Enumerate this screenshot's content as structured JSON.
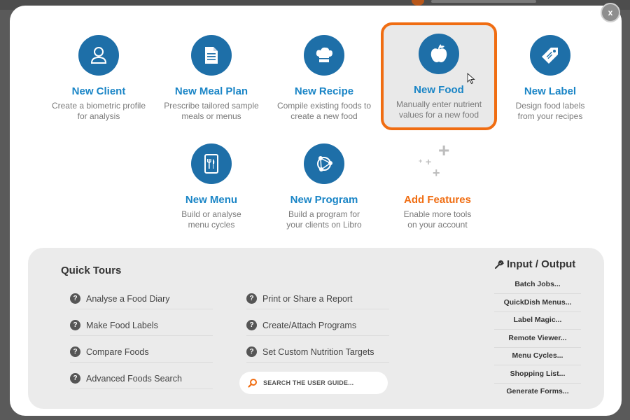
{
  "close_label": "x",
  "tiles": [
    {
      "title": "New Client",
      "desc1": "Create a biometric profile",
      "desc2": "for analysis",
      "icon": "person-icon"
    },
    {
      "title": "New Meal Plan",
      "desc1": "Prescribe tailored sample",
      "desc2": "meals or menus",
      "icon": "document-icon"
    },
    {
      "title": "New Recipe",
      "desc1": "Compile existing foods to",
      "desc2": "create a new food",
      "icon": "chef-hat-icon"
    },
    {
      "title": "New Food",
      "desc1": "Manually enter nutrient",
      "desc2": "values for a new food",
      "icon": "apple-icon"
    },
    {
      "title": "New Label",
      "desc1": "Design food labels",
      "desc2": "from your recipes",
      "icon": "tag-icon"
    },
    {
      "title": "New Menu",
      "desc1": "Build or analyse",
      "desc2": "menu cycles",
      "icon": "tablet-utensils-icon"
    },
    {
      "title": "New Program",
      "desc1": "Build a program for",
      "desc2": "your clients on Libro",
      "icon": "network-icon"
    },
    {
      "title": "Add Features",
      "desc1": "Enable more tools",
      "desc2": "on your account",
      "icon": "plus-icon"
    }
  ],
  "quick_tours": {
    "title": "Quick Tours",
    "left": [
      "Analyse a Food Diary",
      "Make Food Labels",
      "Compare Foods",
      "Advanced Foods Search"
    ],
    "right": [
      "Print or Share a Report",
      "Create/Attach Programs",
      "Set Custom Nutrition Targets"
    ],
    "search_placeholder": "SEARCH THE USER GUIDE..."
  },
  "io": {
    "title": "Input / Output",
    "items": [
      "Batch Jobs...",
      "QuickDish Menus...",
      "Label Magic...",
      "Remote Viewer...",
      "Menu Cycles...",
      "Shopping List...",
      "Generate Forms..."
    ]
  },
  "colors": {
    "primary_blue": "#1e6fa8",
    "title_blue": "#1a85c6",
    "accent_orange": "#f06d12"
  }
}
